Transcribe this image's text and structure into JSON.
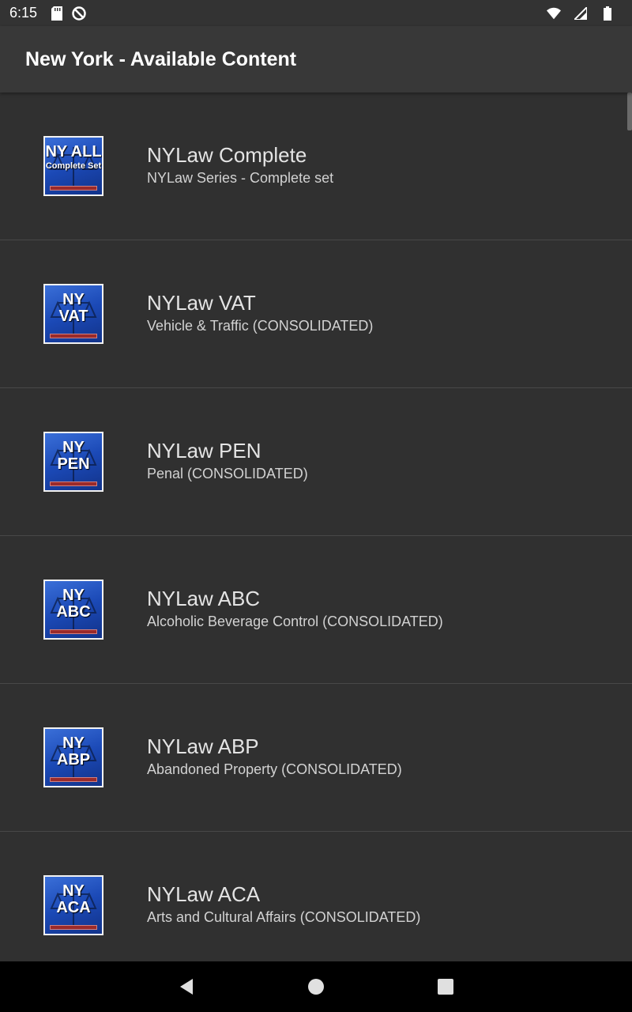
{
  "status_bar": {
    "time": "6:15",
    "left_icons": [
      "sd-card-icon",
      "sync-blocked-icon"
    ],
    "right_icons": [
      "wifi-icon",
      "cellular-signal-icon",
      "battery-icon"
    ]
  },
  "app_bar": {
    "title": "New York - Available Content"
  },
  "items": [
    {
      "thumb_line1": "NY ALL",
      "thumb_line2": "Complete Set",
      "title": "NYLaw Complete",
      "subtitle": "NYLaw Series - Complete set"
    },
    {
      "thumb_line1": "NY",
      "thumb_line2": "VAT",
      "title": "NYLaw VAT",
      "subtitle": "Vehicle & Traffic (CONSOLIDATED)"
    },
    {
      "thumb_line1": "NY",
      "thumb_line2": "PEN",
      "title": "NYLaw PEN",
      "subtitle": "Penal (CONSOLIDATED)"
    },
    {
      "thumb_line1": "NY",
      "thumb_line2": "ABC",
      "title": "NYLaw ABC",
      "subtitle": "Alcoholic Beverage Control (CONSOLIDATED)"
    },
    {
      "thumb_line1": "NY",
      "thumb_line2": "ABP",
      "title": "NYLaw ABP",
      "subtitle": "Abandoned Property (CONSOLIDATED)"
    },
    {
      "thumb_line1": "NY",
      "thumb_line2": "ACA",
      "title": "NYLaw ACA",
      "subtitle": "Arts and Cultural Affairs (CONSOLIDATED)"
    }
  ],
  "nav_bar": {
    "buttons": [
      "back-icon",
      "home-icon",
      "recents-icon"
    ]
  },
  "colors": {
    "background": "#303030",
    "app_bar": "#383838",
    "thumb_blue": "#1b49b6"
  }
}
